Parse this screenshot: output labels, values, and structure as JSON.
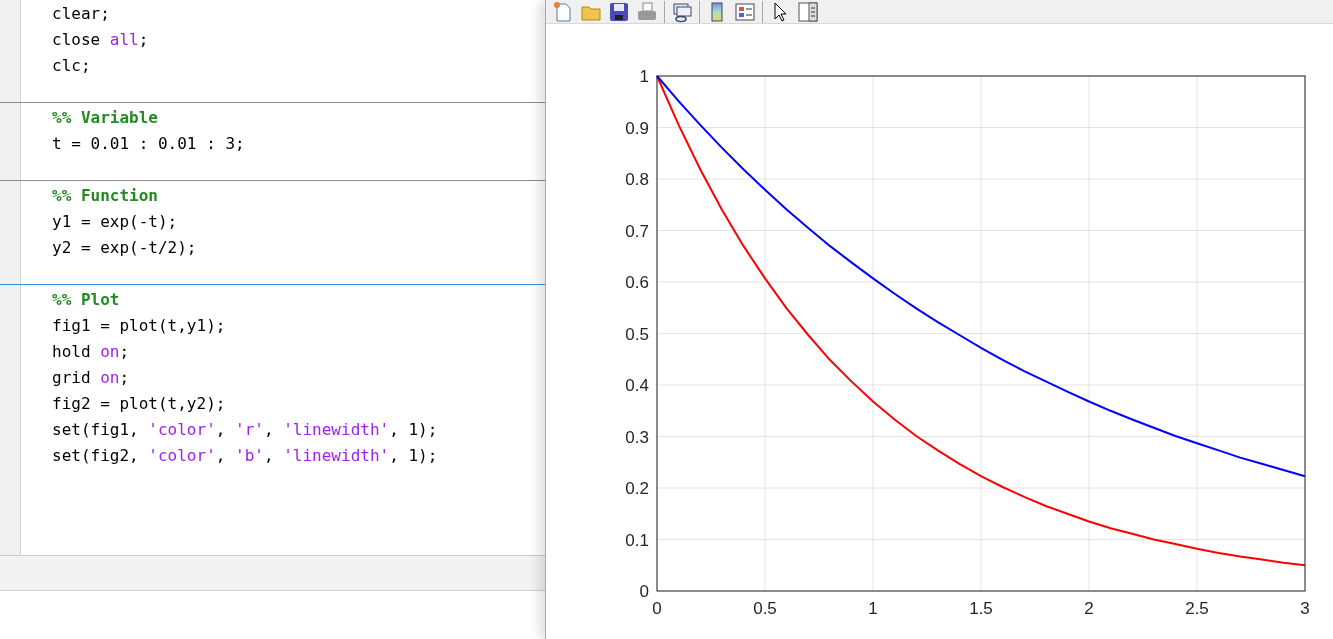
{
  "editor": {
    "sections": [
      {
        "selected": false,
        "lines": [
          [
            {
              "kind": "plain",
              "text": "clear;"
            }
          ],
          [
            {
              "kind": "plain",
              "text": "close "
            },
            {
              "kind": "keyword",
              "text": "all"
            },
            {
              "kind": "plain",
              "text": ";"
            }
          ],
          [
            {
              "kind": "plain",
              "text": "clc;"
            }
          ]
        ]
      },
      {
        "selected": false,
        "lines": [
          [
            {
              "kind": "section",
              "text": "%% Variable"
            }
          ],
          [
            {
              "kind": "plain",
              "text": "t = 0.01 : 0.01 : 3;"
            }
          ]
        ]
      },
      {
        "selected": false,
        "lines": [
          [
            {
              "kind": "section",
              "text": "%% Function"
            }
          ],
          [
            {
              "kind": "plain",
              "text": "y1 = exp(-t);"
            }
          ],
          [
            {
              "kind": "plain",
              "text": "y2 = exp(-t/2);"
            }
          ]
        ]
      },
      {
        "selected": true,
        "lines": [
          [
            {
              "kind": "section",
              "text": "%% Plot"
            }
          ],
          [
            {
              "kind": "plain",
              "text": "fig1 = plot(t,y1);"
            }
          ],
          [
            {
              "kind": "plain",
              "text": "hold "
            },
            {
              "kind": "keyword",
              "text": "on"
            },
            {
              "kind": "plain",
              "text": ";"
            }
          ],
          [
            {
              "kind": "plain",
              "text": "grid "
            },
            {
              "kind": "keyword",
              "text": "on"
            },
            {
              "kind": "plain",
              "text": ";"
            }
          ],
          [
            {
              "kind": "plain",
              "text": "fig2 = plot(t,y2);"
            }
          ],
          [
            {
              "kind": "plain",
              "text": "set(fig1, "
            },
            {
              "kind": "string",
              "text": "'color'"
            },
            {
              "kind": "plain",
              "text": ", "
            },
            {
              "kind": "string",
              "text": "'r'"
            },
            {
              "kind": "plain",
              "text": ", "
            },
            {
              "kind": "string",
              "text": "'linewidth'"
            },
            {
              "kind": "plain",
              "text": ", 1);"
            }
          ],
          [
            {
              "kind": "plain",
              "text": "set(fig2, "
            },
            {
              "kind": "string",
              "text": "'color'"
            },
            {
              "kind": "plain",
              "text": ", "
            },
            {
              "kind": "string",
              "text": "'b'"
            },
            {
              "kind": "plain",
              "text": ", "
            },
            {
              "kind": "string",
              "text": "'linewidth'"
            },
            {
              "kind": "plain",
              "text": ", 1);"
            }
          ]
        ]
      }
    ]
  },
  "figure": {
    "chart_data": {
      "type": "line",
      "x": [
        0,
        0.1,
        0.2,
        0.3,
        0.4,
        0.5,
        0.6,
        0.7,
        0.8,
        0.9,
        1,
        1.1,
        1.2,
        1.3,
        1.4,
        1.5,
        1.6,
        1.7,
        1.8,
        1.9,
        2,
        2.1,
        2.2,
        2.3,
        2.4,
        2.5,
        2.6,
        2.7,
        2.8,
        2.9,
        3
      ],
      "series": [
        {
          "color": "#ff0000",
          "values": [
            1,
            0.905,
            0.819,
            0.741,
            0.67,
            0.607,
            0.549,
            0.497,
            0.449,
            0.407,
            0.368,
            0.333,
            0.301,
            0.273,
            0.247,
            0.223,
            0.202,
            0.183,
            0.165,
            0.15,
            0.135,
            0.122,
            0.111,
            0.1,
            0.091,
            0.082,
            0.074,
            0.067,
            0.061,
            0.055,
            0.05
          ]
        },
        {
          "color": "#0000ff",
          "values": [
            1,
            0.951,
            0.905,
            0.861,
            0.819,
            0.779,
            0.741,
            0.705,
            0.67,
            0.638,
            0.607,
            0.577,
            0.549,
            0.522,
            0.497,
            0.472,
            0.449,
            0.427,
            0.407,
            0.387,
            0.368,
            0.35,
            0.333,
            0.317,
            0.301,
            0.287,
            0.273,
            0.259,
            0.247,
            0.235,
            0.223
          ]
        }
      ],
      "grid": true,
      "xlim": [
        0,
        3
      ],
      "ylim": [
        0,
        1
      ],
      "xticks": [
        0,
        {
          "value": 0.5,
          "label": "0.5"
        },
        1,
        {
          "value": 1.5,
          "label": "1.5"
        },
        2,
        {
          "value": 2.5,
          "label": "2.5"
        },
        3
      ],
      "yticks": [
        0,
        {
          "value": 0.1,
          "label": "0.1"
        },
        {
          "value": 0.2,
          "label": "0.2"
        },
        {
          "value": 0.3,
          "label": "0.3"
        },
        {
          "value": 0.4,
          "label": "0.4"
        },
        {
          "value": 0.5,
          "label": "0.5"
        },
        {
          "value": 0.6,
          "label": "0.6"
        },
        {
          "value": 0.7,
          "label": "0.7"
        },
        {
          "value": 0.8,
          "label": "0.8"
        },
        {
          "value": 0.9,
          "label": "0.9"
        },
        1
      ]
    }
  }
}
